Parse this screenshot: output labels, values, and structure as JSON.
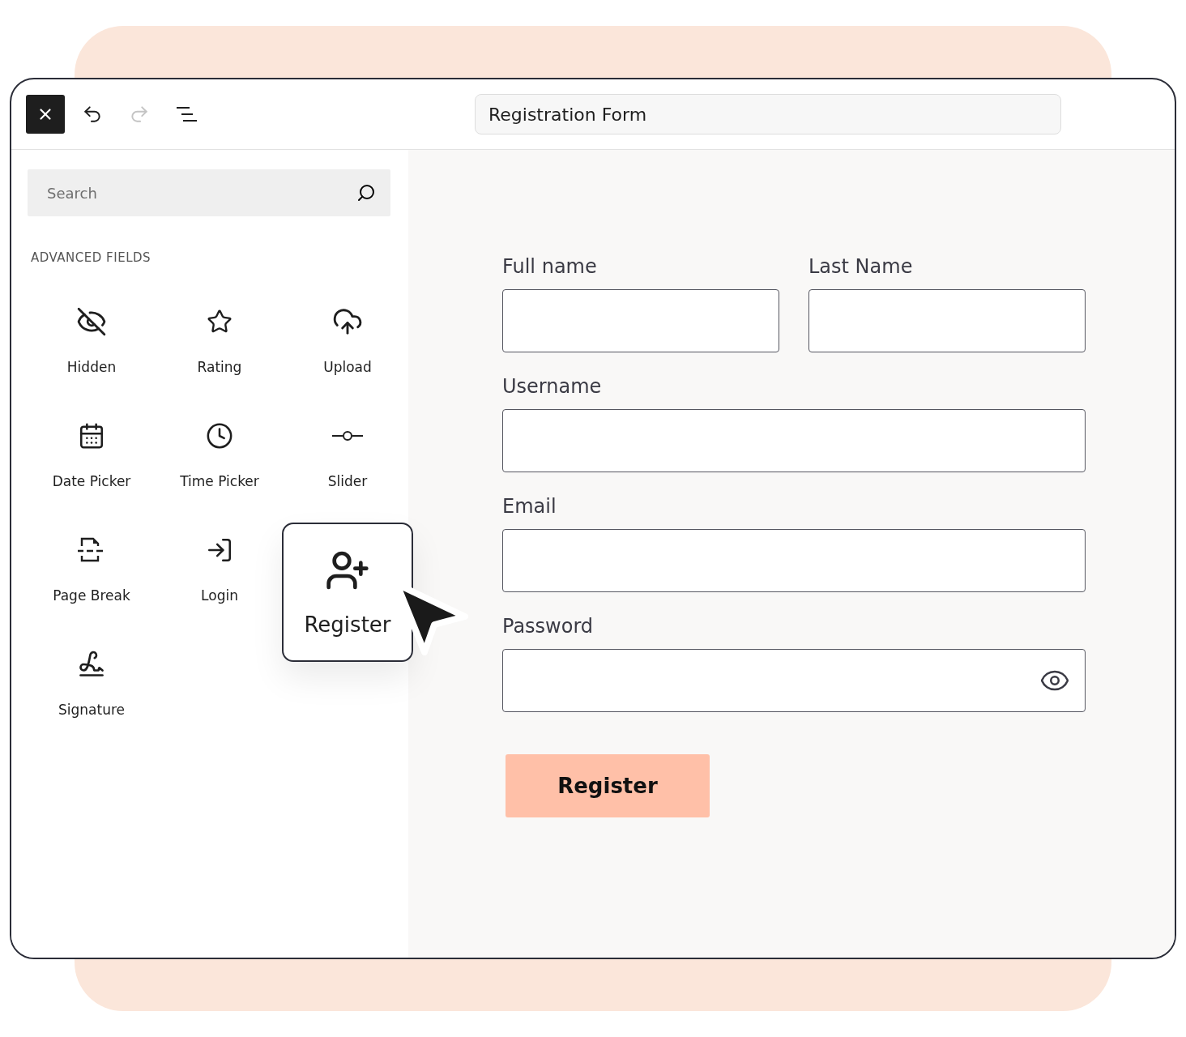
{
  "toolbar": {
    "buttons": [
      {
        "kind": "close",
        "disabled": false
      },
      {
        "kind": "undo",
        "disabled": false
      },
      {
        "kind": "redo",
        "disabled": true
      },
      {
        "kind": "outline",
        "disabled": false
      }
    ],
    "title": "Registration Form"
  },
  "sidebar": {
    "search": {
      "placeholder": "Search"
    },
    "section": "ADVANCED FIELDS",
    "items": [
      {
        "kind": "hidden",
        "label": "Hidden"
      },
      {
        "kind": "rating",
        "label": "Rating"
      },
      {
        "kind": "upload",
        "label": "Upload"
      },
      {
        "kind": "date",
        "label": "Date Picker"
      },
      {
        "kind": "time",
        "label": "Time Picker"
      },
      {
        "kind": "slider",
        "label": "Slider"
      },
      {
        "kind": "pagebreak",
        "label": "Page Break"
      },
      {
        "kind": "login",
        "label": "Login"
      },
      {
        "kind": "signature",
        "label": "Signature"
      }
    ],
    "dragged": {
      "kind": "register",
      "label": "Register"
    }
  },
  "form": {
    "rows": [
      {
        "fields": [
          {
            "label": "Full name",
            "kind": "text"
          },
          {
            "label": "Last Name",
            "kind": "text"
          }
        ]
      },
      {
        "fields": [
          {
            "label": "Username",
            "kind": "text"
          }
        ]
      },
      {
        "fields": [
          {
            "label": "Email",
            "kind": "text"
          }
        ]
      },
      {
        "fields": [
          {
            "label": "Password",
            "kind": "password"
          }
        ]
      }
    ],
    "submit": "Register"
  }
}
